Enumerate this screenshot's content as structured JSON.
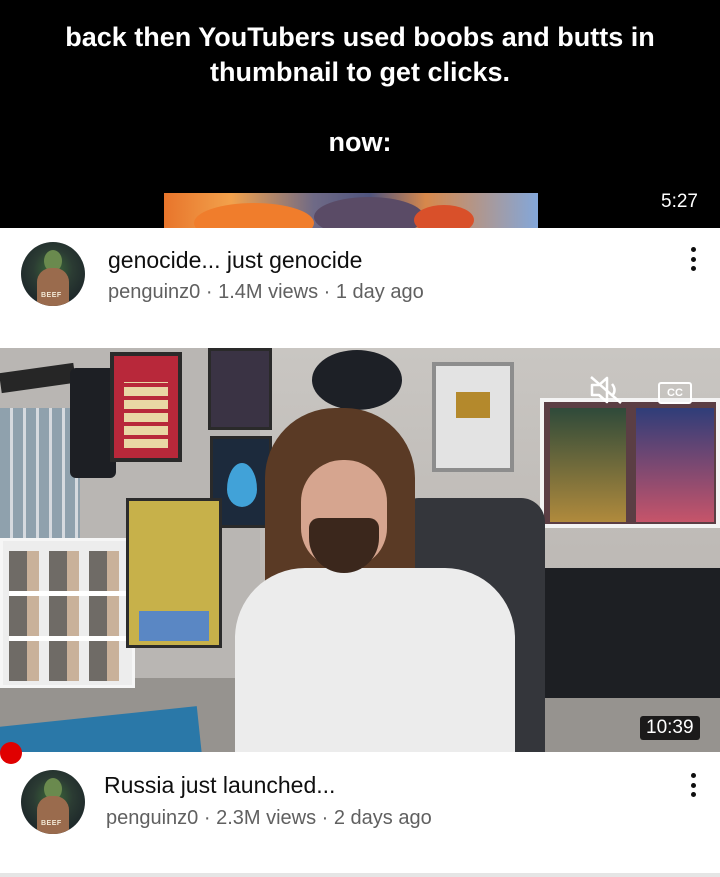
{
  "caption": {
    "line1": "back then YouTubers used boobs and butts in",
    "line2": "thumbnail to get clicks.",
    "line3": "now:"
  },
  "videos": [
    {
      "duration": "5:27",
      "title": "genocide... just genocide",
      "meta": "penguinz0 · 1.4M views · 1 day ago",
      "avatar_tag": "BEEF"
    },
    {
      "duration": "10:39",
      "title": "Russia just launched...",
      "meta": "penguinz0 · 2.3M views · 2 days ago",
      "avatar_tag": "BEEF",
      "thumbnail_overlay": {
        "cc_label": "CC",
        "icons": [
          "mute-icon",
          "cc-icon"
        ]
      }
    }
  ],
  "colors": {
    "caption_bg": "#000000",
    "caption_text": "#ffffff",
    "title_text": "#0f0f0f",
    "meta_text": "#606060",
    "record_dot": "#e00000"
  }
}
